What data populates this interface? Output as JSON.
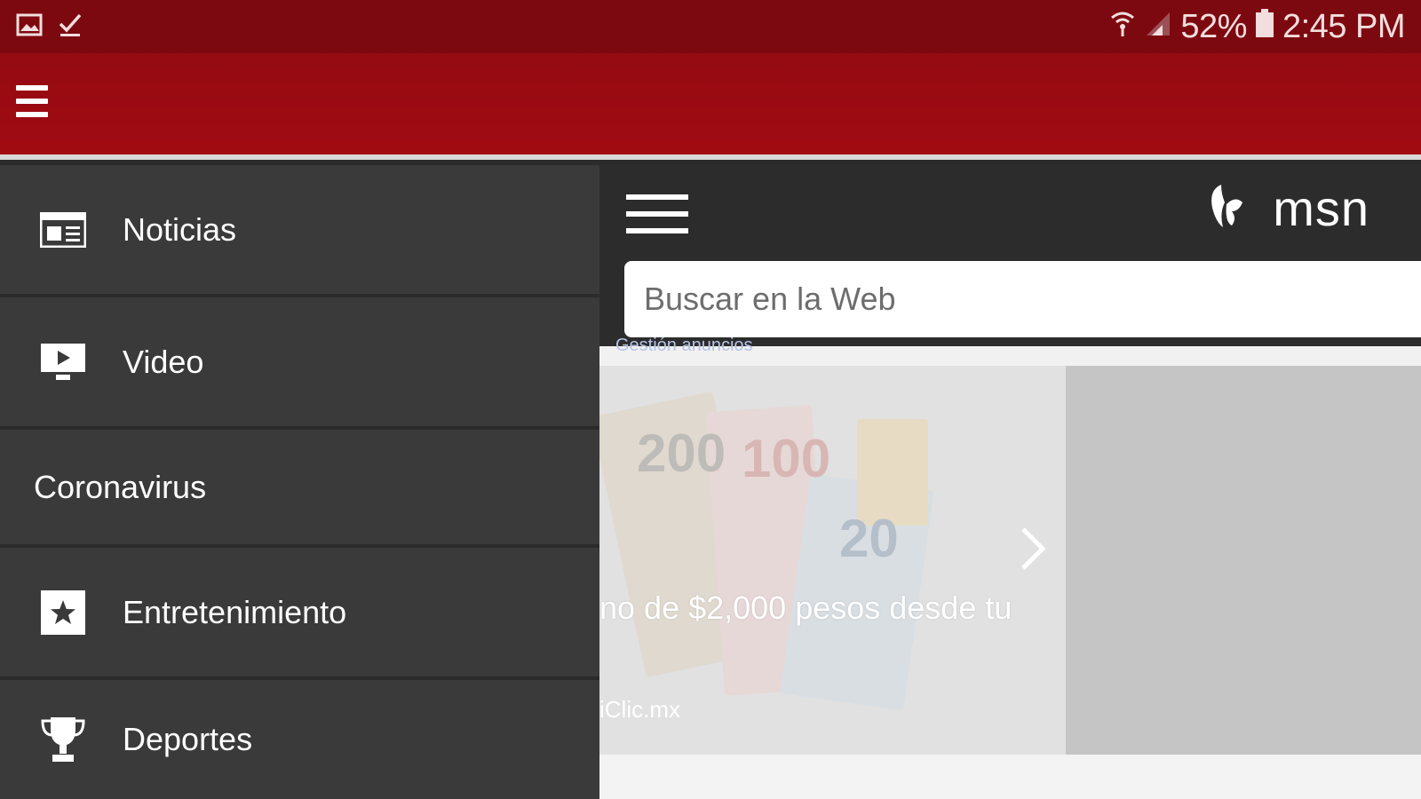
{
  "status_bar": {
    "battery": "52%",
    "time": "2:45 PM",
    "icons": [
      "image-icon",
      "check-icon",
      "wifi-icon",
      "signal-icon",
      "battery-icon"
    ]
  },
  "colors": {
    "status_bar": "#7d0910",
    "app_bar": "#a10b12",
    "drawer": "#3a3a3a",
    "msn_header": "#2c2c2c"
  },
  "drawer": {
    "items": [
      {
        "label": "Noticias",
        "icon": "newspaper-icon"
      },
      {
        "label": "Video",
        "icon": "video-icon"
      },
      {
        "label": "Coronavirus",
        "icon": ""
      },
      {
        "label": "Entretenimiento",
        "icon": "star-icon"
      },
      {
        "label": "Deportes",
        "icon": "trophy-icon"
      }
    ]
  },
  "msn": {
    "brand": "msn",
    "search_placeholder": "Buscar en la Web",
    "ad_label": "Gestión anuncios",
    "hero_title": "no de $2,000 pesos desde tu",
    "hero_source": "iClic.mx"
  }
}
